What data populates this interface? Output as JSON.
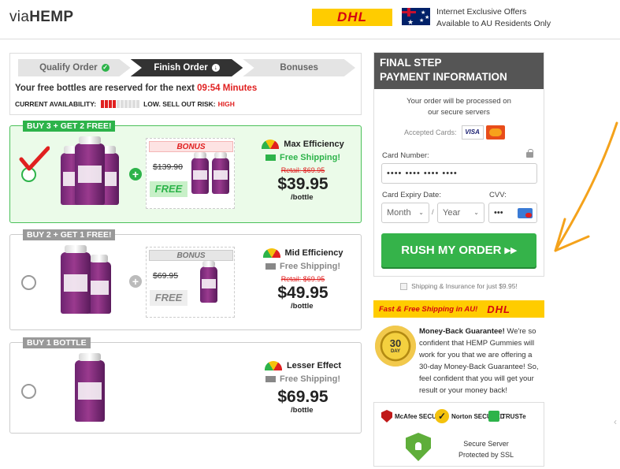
{
  "header": {
    "logo_light": "via",
    "logo_bold": "HEMP",
    "dhl_logo": "DHL",
    "notice_line1": "Internet Exclusive Offers",
    "notice_line2": "Available to AU Residents Only"
  },
  "steps": {
    "items": [
      "Qualify Order",
      "Finish Order",
      "Bonuses"
    ],
    "reserve_text": "Your free bottles are reserved for the next",
    "timer": "09:54 Minutes",
    "availability_label": "CURRENT AVAILABILITY:",
    "availability_level": "LOW.",
    "risk_label": "SELL OUT RISK:",
    "risk_value": "HIGH",
    "availability_fill": 0.4
  },
  "packages": [
    {
      "tag": "BUY 3 + GET 2 FREE!",
      "bonus_label": "BONUS",
      "bonus_old_price": "$139.90",
      "bonus_free": "FREE",
      "efficiency": "Max Efficiency",
      "shipping": "Free Shipping!",
      "retail": "Retail: $69.95",
      "price": "$39.95",
      "per": "/bottle",
      "selected": true
    },
    {
      "tag": "BUY 2 + GET 1 FREE!",
      "bonus_label": "BONUS",
      "bonus_old_price": "$69.95",
      "bonus_free": "FREE",
      "efficiency": "Mid Efficiency",
      "shipping": "Free Shipping!",
      "retail": "Retail: $69.95",
      "price": "$49.95",
      "per": "/bottle",
      "selected": false
    },
    {
      "tag": "BUY 1 BOTTLE",
      "efficiency": "Lesser Effect",
      "shipping": "Free Shipping!",
      "price": "$69.95",
      "per": "/bottle",
      "selected": false
    }
  ],
  "payment": {
    "title_line1": "FINAL STEP",
    "title_line2": "PAYMENT INFORMATION",
    "secure_line1": "Your order will be processed on",
    "secure_line2": "our secure servers",
    "accepted_cards": "Accepted Cards:",
    "card_visa": "VISA",
    "card_number_label": "Card Number:",
    "card_number_placeholder": "•••• •••• •••• ••••",
    "expiry_label": "Card Expiry Date:",
    "month": "Month",
    "year": "Year",
    "cvv_label": "CVV:",
    "cvv_placeholder": "•••",
    "cvv_card_text": "CVV",
    "submit": "RUSH MY ORDER ▸▸",
    "insurance": "Shipping & Insurance for just $9.95!"
  },
  "shipping_banner": {
    "text": "Fast & Free Shipping in AU!",
    "logo": "DHL"
  },
  "guarantee": {
    "seal_days": "30",
    "seal_day": "DAY",
    "title": "Money-Back Guarantee!",
    "body": "We're so confident that HEMP Gummies will work for you that we are offering a 30-day Money-Back Guarantee! So, feel confident that you will get your result or your money back!"
  },
  "trust": {
    "badges": [
      "McAfee SECURE",
      "Norton SECURED",
      "TRUSTe"
    ],
    "server_line1": "Secure Server",
    "server_line2": "Protected by SSL"
  },
  "colors": {
    "green": "#2db34a",
    "red": "#e02020",
    "dhl_yellow": "#ffcc00",
    "dhl_red": "#d40511",
    "header_gray": "#555555",
    "arrow_orange": "#f4a21b"
  }
}
